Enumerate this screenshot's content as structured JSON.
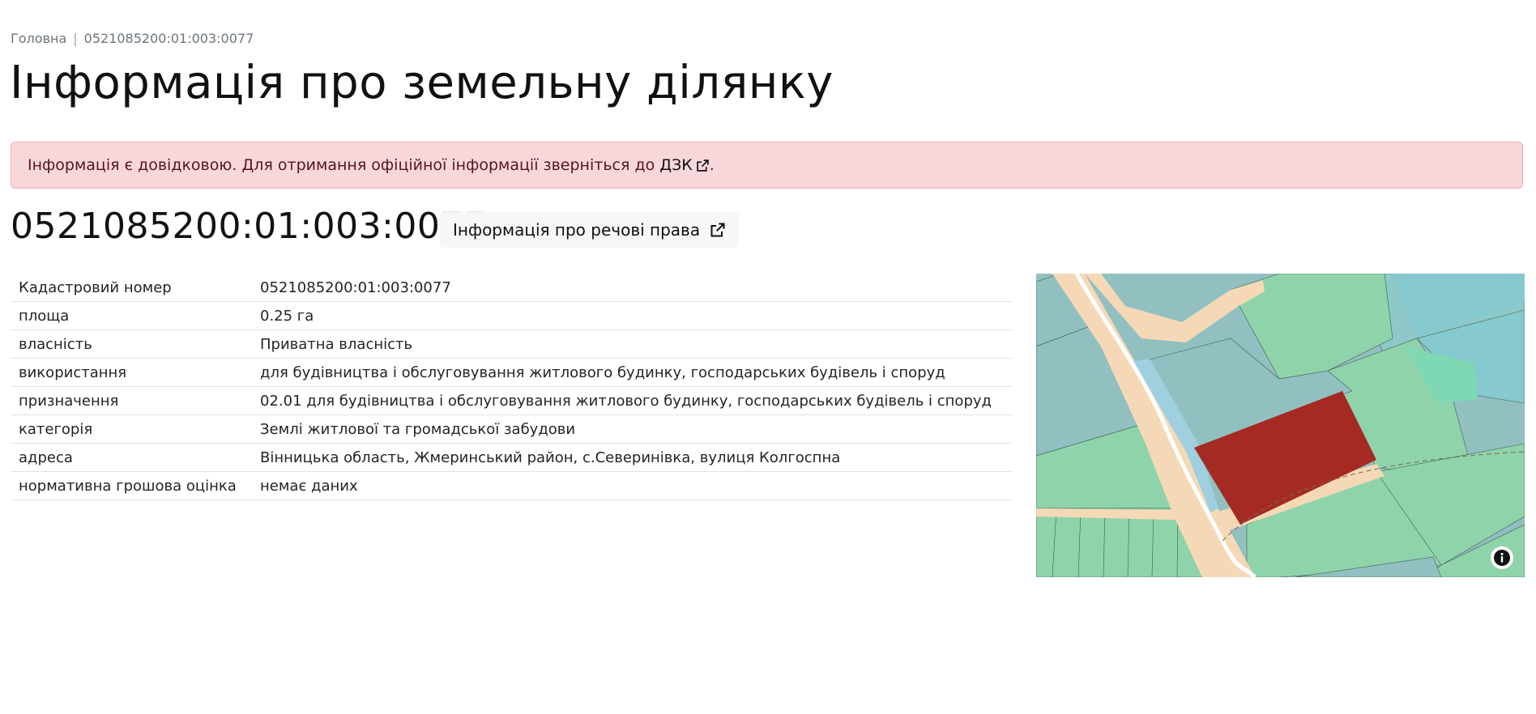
{
  "breadcrumb": {
    "home": "Головна",
    "separator": "|",
    "current": "0521085200:01:003:0077"
  },
  "page_title": "Інформація про земельну ділянку",
  "alert": {
    "text": "Інформація є довідковою. Для отримання офіційної інформації зверніться до",
    "link": "ДЗК",
    "suffix": ".",
    "bg_color": "#f8d7da"
  },
  "parcel": {
    "number": "0521085200:01:003:0077",
    "rights_button": "Інформація про речові права"
  },
  "info_rows": [
    {
      "key": "Кадастровий номер",
      "value": "0521085200:01:003:0077"
    },
    {
      "key": "площа",
      "value": "0.25 га"
    },
    {
      "key": "власність",
      "value": "Приватна власність"
    },
    {
      "key": "використання",
      "value": "для будівництва і обслуговування житлового будинку, господарських будівель і споруд"
    },
    {
      "key": "призначення",
      "value": "02.01 для будівництва і обслуговування житлового будинку, господарських будівель і споруд"
    },
    {
      "key": "категорія",
      "value": "Землі житлової та громадської забудови"
    },
    {
      "key": "адреса",
      "value": "Вінницька область, Жмеринський район, с.Северинівка, вулиця Колгоспна"
    },
    {
      "key": "нормативна грошова оцінка",
      "value": "немає даних"
    }
  ],
  "map": {
    "highlight_color": "#a52a24",
    "road_color": "#f5d9b6",
    "parcel_green": "#8fd3ab",
    "parcel_teal": "#92c0c0",
    "info_icon": "info-icon"
  },
  "icons": {
    "external_link": "external-link-icon"
  }
}
